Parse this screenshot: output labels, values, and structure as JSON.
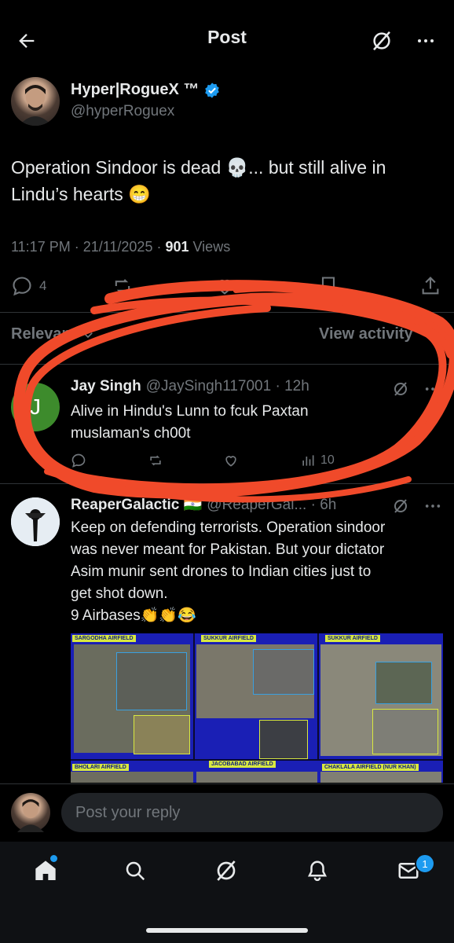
{
  "header": {
    "title": "Post"
  },
  "post": {
    "author_name": "Hyper|RogueX ™",
    "author_handle": "@hyperRoguex",
    "text_line1": "Operation Sindoor is dead 💀... but still alive in",
    "text_line2": "Lindu’s hearts 😁",
    "time_date": "11:17 PM · 21/11/2025 · ",
    "views_count": "901",
    "views_label": " Views",
    "reply_count": "4"
  },
  "filter": {
    "sort_label": "Relevant",
    "view_activity_label": "View activity"
  },
  "replies": [
    {
      "avatar_letter": "J",
      "name": "Jay Singh",
      "handle": "@JaySingh117001 · 12h",
      "line1": "Alive in Hindu's Lunn to fcuk Paxtan",
      "line2": "muslaman's ch00t",
      "views": "10"
    },
    {
      "name": "ReaperGalactic 🇮🇳",
      "handle": "@ReaperGal... · 6h",
      "line1": "Keep on defending terrorists. Operation sindoor",
      "line2": "was never meant for Pakistan. But your dictator",
      "line3": "Asim munir sent drones to Indian cities just to",
      "line4": "get shot down.",
      "line5": "9 Airbases👏👏😂",
      "media_labels": [
        "SARGODHA AIRFIELD",
        "SUKKUR AIRFIELD",
        "SUKKUR AIRFIELD",
        "BHOLARI AIRFIELD",
        "JACOBABAD AIRFIELD",
        "CHAKLALA AIRFIELD (NUR KHAN)"
      ]
    }
  ],
  "compose": {
    "placeholder": "Post your reply"
  },
  "tabbar": {
    "messages_badge": "1"
  },
  "colors": {
    "accent": "#1d9bf0",
    "scribble": "#f04a2a"
  }
}
